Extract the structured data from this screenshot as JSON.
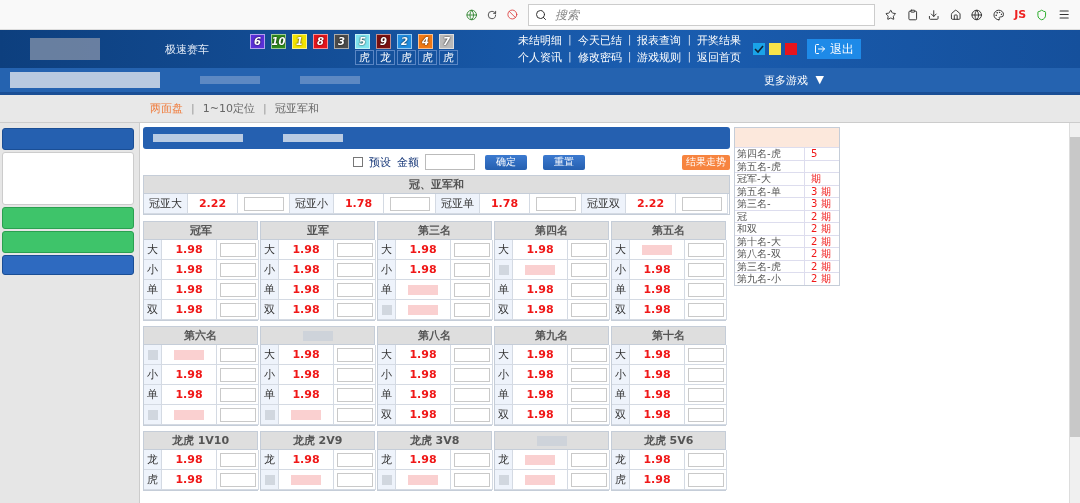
{
  "browser": {
    "search": {
      "placeholder": "搜索"
    },
    "badge": "JS"
  },
  "header": {
    "game_title": "极速赛车",
    "balls": [
      {
        "number": "6",
        "color": "#5a2fd8"
      },
      {
        "number": "10",
        "color": "#2f8c1f"
      },
      {
        "number": "1",
        "color": "#f2e400"
      },
      {
        "number": "8",
        "color": "#e3141c"
      },
      {
        "number": "3",
        "color": "#4a4a4a"
      },
      {
        "number": "5",
        "color": "#7fe3ee"
      },
      {
        "number": "9",
        "color": "#7a1010"
      },
      {
        "number": "2",
        "color": "#1f8de0"
      },
      {
        "number": "4",
        "color": "#f07814"
      },
      {
        "number": "7",
        "color": "#b9b9b9"
      }
    ],
    "ball_tags": [
      "虎",
      "龙",
      "虎",
      "虎",
      "虎"
    ],
    "links": [
      {
        "label": "未结明细"
      },
      {
        "separator": "|",
        "label": "今天已结"
      },
      {
        "separator": "|",
        "label": "报表查询"
      },
      {
        "separator": "|",
        "label": "开奖结果"
      },
      {
        "label": "个人资讯"
      },
      {
        "separator": "|",
        "label": "修改密码"
      },
      {
        "separator": "|",
        "label": "游戏规则"
      },
      {
        "separator": "|",
        "label": "返回首页"
      }
    ],
    "themes": [
      {
        "color": "#1aa3e8",
        "selected": true
      },
      {
        "color": "#f7e34a",
        "selected": false
      },
      {
        "color": "#e8141c",
        "selected": false
      }
    ],
    "logout": "退出"
  },
  "nav": {
    "more": "更多游戏",
    "caret": "▼"
  },
  "subnav": [
    {
      "label": "两面盘",
      "selected": true
    },
    {
      "separator": "|",
      "label": "1~10定位",
      "selected": false
    },
    {
      "separator": "|",
      "label": "冠亚军和",
      "selected": false
    }
  ],
  "bet_form": {
    "preset_label": "预设",
    "preset_checked": false,
    "amount_label": "金额",
    "confirm": "确定",
    "reset": "重置",
    "trend": "结果走势"
  },
  "sum_table": {
    "title": "冠、亚军和",
    "cells": [
      {
        "label": "冠亚大",
        "odds": "2.22"
      },
      {
        "label": "冠亚小",
        "odds": "1.78"
      },
      {
        "label": "冠亚单",
        "odds": "1.78"
      },
      {
        "label": "冠亚双",
        "odds": "2.22"
      }
    ]
  },
  "groups": [
    {
      "title": "冠军",
      "rows": [
        {
          "label": "大",
          "odds": "1.98"
        },
        {
          "label": "小",
          "odds": "1.98"
        },
        {
          "label": "单",
          "odds": "1.98"
        },
        {
          "label": "双",
          "odds": "1.98"
        }
      ]
    },
    {
      "title": "亚军",
      "rows": [
        {
          "label": "大",
          "odds": "1.98"
        },
        {
          "label": "小",
          "odds": "1.98"
        },
        {
          "label": "单",
          "odds": "1.98"
        },
        {
          "label": "双",
          "odds": "1.98"
        }
      ]
    },
    {
      "title": "第三名",
      "rows": [
        {
          "label": "大",
          "odds": "1.98"
        },
        {
          "label": "小",
          "odds": "1.98"
        },
        {
          "label": "单"
        },
        {}
      ]
    },
    {
      "title": "第四名",
      "rows": [
        {
          "label": "大",
          "odds": "1.98"
        },
        {},
        {
          "label": "单",
          "odds": "1.98"
        },
        {
          "label": "双",
          "odds": "1.98"
        }
      ]
    },
    {
      "title": "第五名",
      "rows": [
        {
          "label": "大"
        },
        {
          "label": "小",
          "odds": "1.98"
        },
        {
          "label": "单",
          "odds": "1.98"
        },
        {
          "label": "双",
          "odds": "1.98"
        }
      ]
    },
    {
      "title": "第六名",
      "rows": [
        {},
        {
          "label": "小",
          "odds": "1.98"
        },
        {
          "label": "单",
          "odds": "1.98"
        },
        {}
      ]
    },
    {
      "rows": [
        {
          "label": "大",
          "odds": "1.98"
        },
        {
          "label": "小",
          "odds": "1.98"
        },
        {
          "label": "单",
          "odds": "1.98"
        },
        {}
      ]
    },
    {
      "title": "第八名",
      "rows": [
        {
          "label": "大",
          "odds": "1.98"
        },
        {
          "label": "小",
          "odds": "1.98"
        },
        {
          "label": "单",
          "odds": "1.98"
        },
        {
          "label": "双",
          "odds": "1.98"
        }
      ]
    },
    {
      "title": "第九名",
      "rows": [
        {
          "label": "大",
          "odds": "1.98"
        },
        {
          "label": "小",
          "odds": "1.98"
        },
        {
          "label": "单",
          "odds": "1.98"
        },
        {
          "label": "双",
          "odds": "1.98"
        }
      ]
    },
    {
      "title": "第十名",
      "rows": [
        {
          "label": "大",
          "odds": "1.98"
        },
        {
          "label": "小",
          "odds": "1.98"
        },
        {
          "label": "单",
          "odds": "1.98"
        },
        {
          "label": "双",
          "odds": "1.98"
        }
      ]
    },
    {
      "title": "龙虎 1V10",
      "rows": [
        {
          "label": "龙",
          "odds": "1.98"
        },
        {
          "label": "虎",
          "odds": "1.98"
        }
      ]
    },
    {
      "title": "龙虎 2V9",
      "rows": [
        {
          "label": "龙",
          "odds": "1.98"
        },
        {}
      ]
    },
    {
      "title": "龙虎 3V8",
      "rows": [
        {
          "label": "龙",
          "odds": "1.98"
        },
        {}
      ]
    },
    {
      "rows": [
        {
          "label": "龙"
        },
        {}
      ]
    },
    {
      "title": "龙虎 5V6",
      "rows": [
        {
          "label": "龙",
          "odds": "1.98"
        },
        {
          "label": "虎",
          "odds": "1.98"
        }
      ]
    }
  ],
  "streaks": [
    {
      "name": "第四名-虎",
      "count": "5"
    },
    {
      "name": "第五名-虎"
    },
    {
      "name": "冠军-大",
      "count": "期"
    },
    {
      "name": "第五名-单",
      "count": "3 期"
    },
    {
      "name": "第三名-",
      "count": "3 期"
    },
    {
      "name": "冠",
      "count": "2 期"
    },
    {
      "name": "和双",
      "count": "2 期"
    },
    {
      "name": "第十名-大",
      "count": "2 期"
    },
    {
      "name": "第八名-双",
      "count": "2 期"
    },
    {
      "name": "第三名-虎",
      "count": "2 期"
    },
    {
      "name": "第九名-小",
      "count": "2 期"
    }
  ]
}
